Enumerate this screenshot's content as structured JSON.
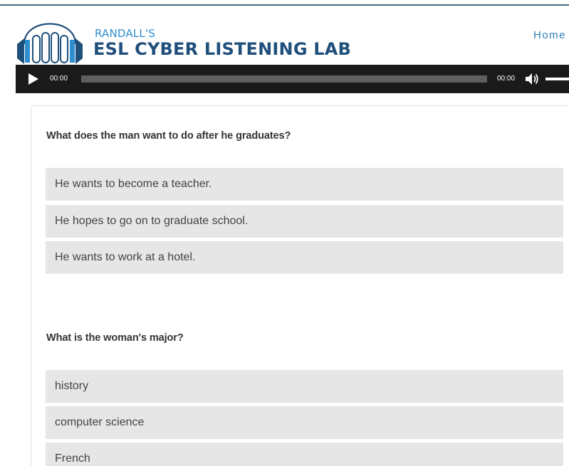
{
  "colors": {
    "brand_light": "#2e8fd0",
    "brand_dark": "#1f4f7b",
    "nav_link": "#2e7fb8",
    "player_bg": "#1a1a1a",
    "option_bg": "#e6e6e6"
  },
  "header": {
    "logo_icon": "headphones-book-logo",
    "brand_top": "RANDALL'S",
    "brand_main": "ESL CYBER LISTENING LAB",
    "nav": {
      "home": "Home"
    }
  },
  "player": {
    "play_icon": "play-icon",
    "current_time": "00:00",
    "duration": "00:00",
    "volume_icon": "speaker-icon"
  },
  "quiz": {
    "questions": [
      {
        "text": "What does the man want to do after he graduates?",
        "options": [
          "He wants to become a teacher.",
          "He hopes to go on to graduate school.",
          "He wants to work at a hotel."
        ]
      },
      {
        "text": "What is the woman's major?",
        "options": [
          "history",
          "computer science",
          "French"
        ]
      }
    ]
  }
}
